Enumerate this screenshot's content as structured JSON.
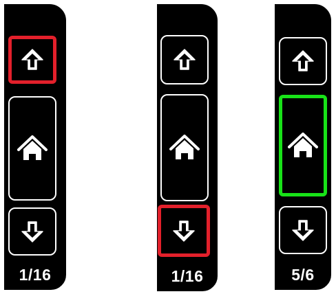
{
  "colors": {
    "background": "#000000",
    "border": "#ffffff",
    "selected_red": "#e3202b",
    "selected_green": "#18e318"
  },
  "panels": [
    {
      "selected": "up",
      "selected_color": "red",
      "buttons": [
        {
          "icon": "arrow-up-icon"
        },
        {
          "icon": "home-icon"
        },
        {
          "icon": "arrow-down-icon"
        }
      ],
      "page_counter": "1/16"
    },
    {
      "selected": "down",
      "selected_color": "red",
      "buttons": [
        {
          "icon": "arrow-up-icon"
        },
        {
          "icon": "home-icon"
        },
        {
          "icon": "arrow-down-icon"
        }
      ],
      "page_counter": "1/16"
    },
    {
      "selected": "home",
      "selected_color": "green",
      "buttons": [
        {
          "icon": "arrow-up-icon"
        },
        {
          "icon": "home-icon"
        },
        {
          "icon": "arrow-down-icon"
        }
      ],
      "page_counter": "5/6"
    }
  ]
}
